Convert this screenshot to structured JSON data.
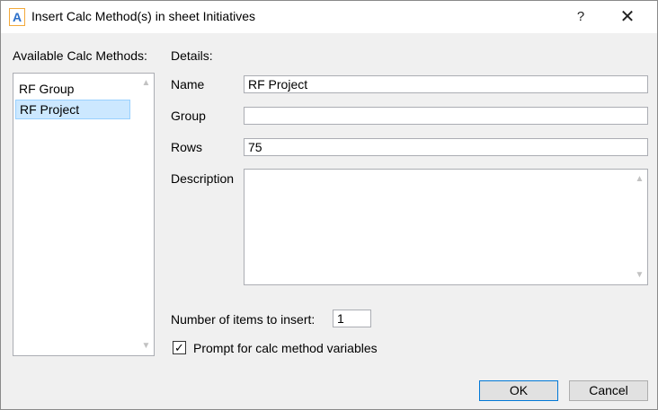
{
  "window": {
    "app_icon_letter": "A",
    "title": "Insert Calc Method(s) in sheet Initiatives",
    "help_symbol": "?",
    "close_symbol": "✕"
  },
  "left_panel": {
    "label": "Available Calc Methods:",
    "items": [
      {
        "label": "RF Group",
        "selected": false
      },
      {
        "label": "RF Project",
        "selected": true
      }
    ]
  },
  "details": {
    "label": "Details:",
    "name_label": "Name",
    "name_value": "RF Project",
    "group_label": "Group",
    "group_value": "",
    "rows_label": "Rows",
    "rows_value": "75",
    "description_label": "Description",
    "description_value": ""
  },
  "options": {
    "items_to_insert_label": "Number of items to insert:",
    "items_to_insert_value": "1",
    "prompt_label": "Prompt for calc method variables",
    "prompt_checked": true,
    "check_symbol": "✓"
  },
  "buttons": {
    "ok": "OK",
    "cancel": "Cancel"
  }
}
